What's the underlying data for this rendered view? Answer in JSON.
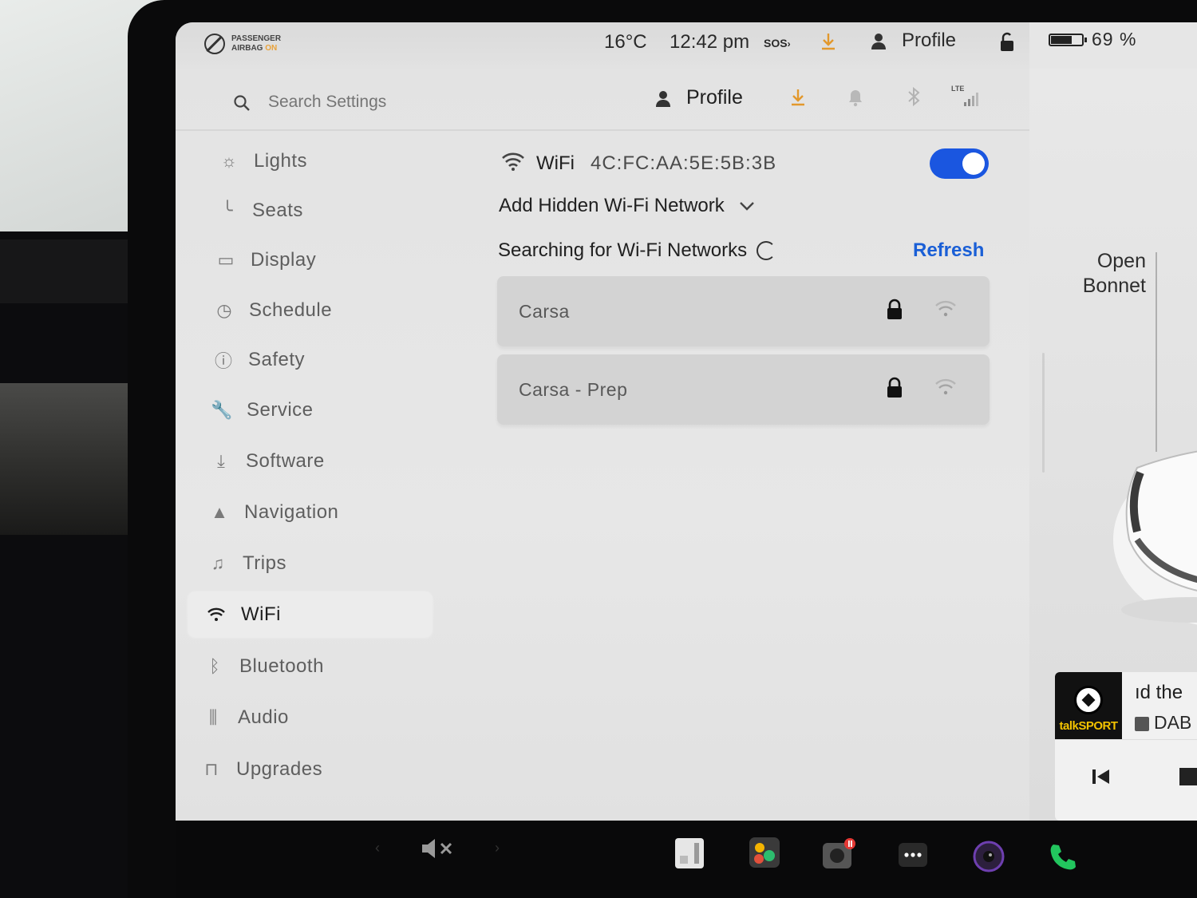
{
  "status_bar": {
    "airbag_line1": "PASSENGER",
    "airbag_line2": "AIRBAG",
    "airbag_state": "ON",
    "temperature": "16°C",
    "time": "12:42 pm",
    "sos": "SOS",
    "profile_label": "Profile",
    "battery_percent": "69 %",
    "battery_level": 0.69
  },
  "settings_header": {
    "search_placeholder": "Search Settings",
    "profile_label": "Profile",
    "lte_label": "LTE"
  },
  "sidebar": {
    "items": [
      {
        "label": "Lights",
        "icon": "sun-icon"
      },
      {
        "label": "Seats",
        "icon": "seat-icon"
      },
      {
        "label": "Display",
        "icon": "display-icon"
      },
      {
        "label": "Schedule",
        "icon": "clock-icon"
      },
      {
        "label": "Safety",
        "icon": "alert-circle-icon"
      },
      {
        "label": "Service",
        "icon": "wrench-icon"
      },
      {
        "label": "Software",
        "icon": "download-icon"
      },
      {
        "label": "Navigation",
        "icon": "navigation-arrow-icon"
      },
      {
        "label": "Trips",
        "icon": "trips-icon"
      },
      {
        "label": "WiFi",
        "icon": "wifi-icon"
      },
      {
        "label": "Bluetooth",
        "icon": "bluetooth-icon"
      },
      {
        "label": "Audio",
        "icon": "equalizer-icon"
      },
      {
        "label": "Upgrades",
        "icon": "bag-icon"
      }
    ],
    "active": "WiFi"
  },
  "wifi": {
    "title": "WiFi",
    "mac_address": "4C:FC:AA:5E:5B:3B",
    "enabled": true,
    "add_hidden_label": "Add Hidden Wi-Fi Network",
    "searching_label": "Searching for Wi-Fi Networks",
    "refresh_label": "Refresh",
    "networks": [
      {
        "name": "Carsa",
        "secured": true
      },
      {
        "name": "Carsa - Prep",
        "secured": true
      }
    ]
  },
  "car_panel": {
    "open_bonnet_line1": "Open",
    "open_bonnet_line2": "Bonnet"
  },
  "media": {
    "station": "talkSPORT",
    "track": "ıd the",
    "source": "DAB"
  },
  "colors": {
    "accent_blue": "#1a56e0",
    "link_blue": "#1a5fd6",
    "download_orange": "#e2982c",
    "phone_green": "#22c55e"
  }
}
